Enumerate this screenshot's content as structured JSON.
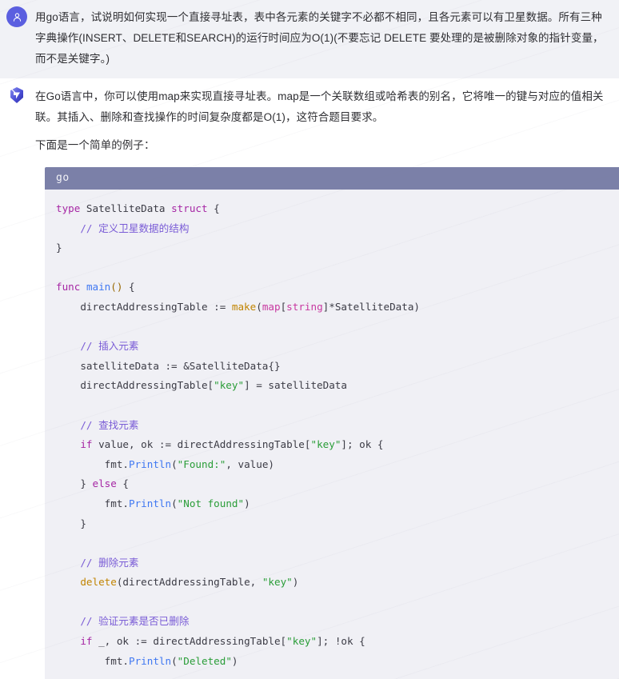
{
  "conversation": {
    "user_message": {
      "avatar_icon": "user-person-icon",
      "text": "用go语言，试说明如何实现一个直接寻址表，表中各元素的关键字不必都不相同，且各元素可以有卫星数据。所有三种字典操作(INSERT、DELETE和SEARCH)的运行时间应为O(1)(不要忘记 DELETE 要处理的是被删除对象的指针变量，而不是关键字。)",
      "bubble_color": "#f1f2f6",
      "avatar_color": "#5b5fe0"
    },
    "assistant_message": {
      "avatar_icon": "assistant-logo-icon",
      "paragraph_1": "在Go语言中，你可以使用map来实现直接寻址表。map是一个关联数组或哈希表的别名，它将唯一的键与对应的值相关联。其插入、删除和查找操作的时间复杂度都是O(1)，这符合题目要求。",
      "paragraph_2": "下面是一个简单的例子："
    }
  },
  "code_block": {
    "language_label": "go",
    "header_color": "#7b80a8",
    "body_color": "#f0f0f5",
    "lines": [
      [
        {
          "t": "kw",
          "s": "type"
        },
        {
          "t": "pl",
          "s": " SatelliteData "
        },
        {
          "t": "kw",
          "s": "struct"
        },
        {
          "t": "pl",
          "s": " {"
        }
      ],
      [
        {
          "t": "pl",
          "s": "    "
        },
        {
          "t": "cm",
          "s": "// 定义卫星数据的结构"
        }
      ],
      [
        {
          "t": "pl",
          "s": "}"
        }
      ],
      [],
      [
        {
          "t": "kw",
          "s": "func"
        },
        {
          "t": "pl",
          "s": " "
        },
        {
          "t": "fn",
          "s": "main"
        },
        {
          "t": "num",
          "s": "()"
        },
        {
          "t": "pl",
          "s": " {"
        }
      ],
      [
        {
          "t": "pl",
          "s": "    directAddressingTable := "
        },
        {
          "t": "bi",
          "s": "make"
        },
        {
          "t": "pl",
          "s": "("
        },
        {
          "t": "type",
          "s": "map"
        },
        {
          "t": "pl",
          "s": "["
        },
        {
          "t": "type",
          "s": "string"
        },
        {
          "t": "pl",
          "s": "]*SatelliteData)"
        }
      ],
      [],
      [
        {
          "t": "pl",
          "s": "    "
        },
        {
          "t": "cm",
          "s": "// 插入元素"
        }
      ],
      [
        {
          "t": "pl",
          "s": "    satelliteData := &SatelliteData{}"
        }
      ],
      [
        {
          "t": "pl",
          "s": "    directAddressingTable["
        },
        {
          "t": "str",
          "s": "\"key\""
        },
        {
          "t": "pl",
          "s": "] = satelliteData"
        }
      ],
      [],
      [
        {
          "t": "pl",
          "s": "    "
        },
        {
          "t": "cm",
          "s": "// 查找元素"
        }
      ],
      [
        {
          "t": "pl",
          "s": "    "
        },
        {
          "t": "kw",
          "s": "if"
        },
        {
          "t": "pl",
          "s": " value, ok := directAddressingTable["
        },
        {
          "t": "str",
          "s": "\"key\""
        },
        {
          "t": "pl",
          "s": "]; ok {"
        }
      ],
      [
        {
          "t": "pl",
          "s": "        fmt."
        },
        {
          "t": "fn",
          "s": "Println"
        },
        {
          "t": "pl",
          "s": "("
        },
        {
          "t": "str",
          "s": "\"Found:\""
        },
        {
          "t": "pl",
          "s": ", value)"
        }
      ],
      [
        {
          "t": "pl",
          "s": "    } "
        },
        {
          "t": "kw",
          "s": "else"
        },
        {
          "t": "pl",
          "s": " {"
        }
      ],
      [
        {
          "t": "pl",
          "s": "        fmt."
        },
        {
          "t": "fn",
          "s": "Println"
        },
        {
          "t": "pl",
          "s": "("
        },
        {
          "t": "str",
          "s": "\"Not found\""
        },
        {
          "t": "pl",
          "s": ")"
        }
      ],
      [
        {
          "t": "pl",
          "s": "    }"
        }
      ],
      [],
      [
        {
          "t": "pl",
          "s": "    "
        },
        {
          "t": "cm",
          "s": "// 删除元素"
        }
      ],
      [
        {
          "t": "pl",
          "s": "    "
        },
        {
          "t": "bi",
          "s": "delete"
        },
        {
          "t": "pl",
          "s": "(directAddressingTable, "
        },
        {
          "t": "str",
          "s": "\"key\""
        },
        {
          "t": "pl",
          "s": ")"
        }
      ],
      [],
      [
        {
          "t": "pl",
          "s": "    "
        },
        {
          "t": "cm",
          "s": "// 验证元素是否已删除"
        }
      ],
      [
        {
          "t": "pl",
          "s": "    "
        },
        {
          "t": "kw",
          "s": "if"
        },
        {
          "t": "pl",
          "s": " _, ok := directAddressingTable["
        },
        {
          "t": "str",
          "s": "\"key\""
        },
        {
          "t": "pl",
          "s": "]; !ok {"
        }
      ],
      [
        {
          "t": "pl",
          "s": "        fmt."
        },
        {
          "t": "fn",
          "s": "Println"
        },
        {
          "t": "pl",
          "s": "("
        },
        {
          "t": "str",
          "s": "\"Deleted\""
        },
        {
          "t": "pl",
          "s": ")"
        }
      ]
    ]
  }
}
